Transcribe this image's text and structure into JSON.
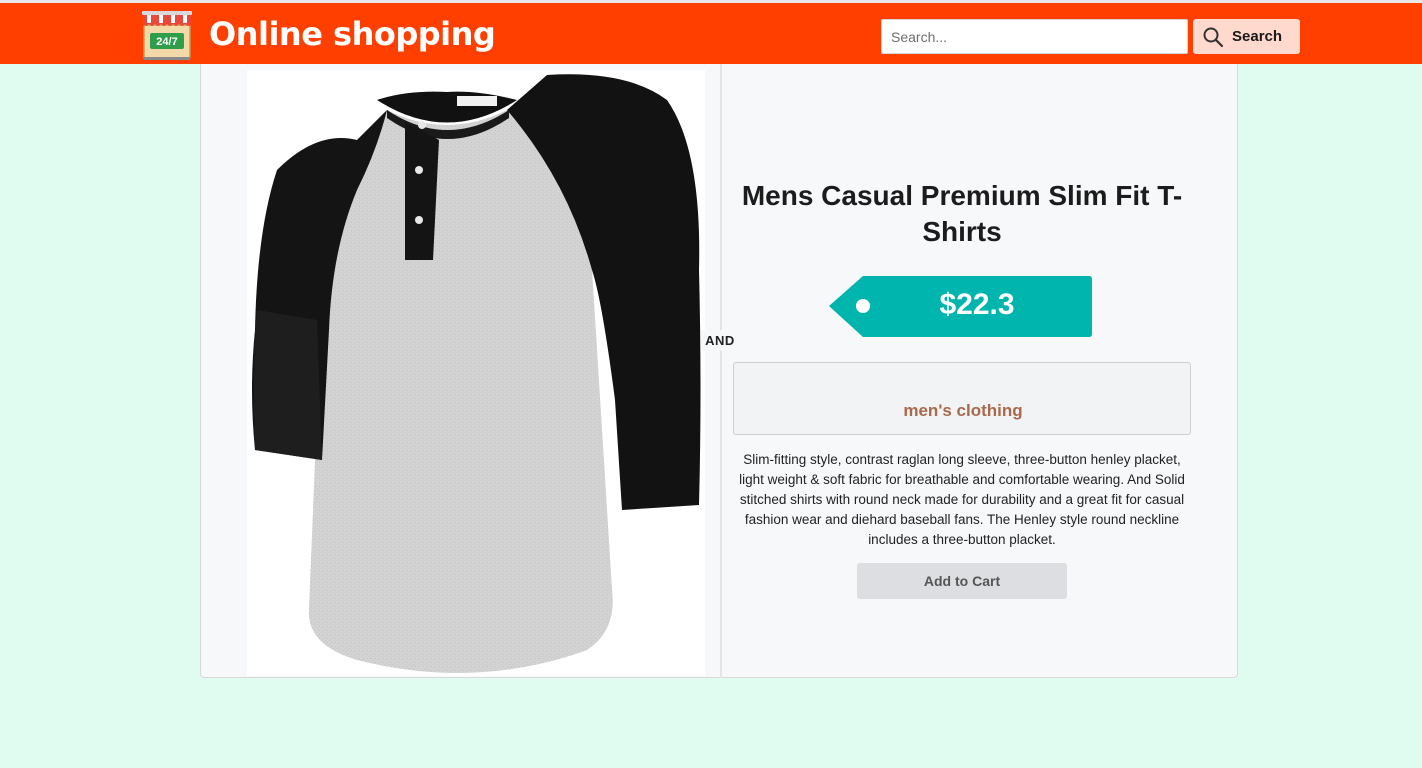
{
  "header": {
    "brand_title": "Online shopping",
    "logo_icon": "store-24-7-icon",
    "logo_text": "24/7",
    "search_placeholder": "Search...",
    "search_value": "",
    "search_button_label": "Search",
    "search_icon": "magnifier-icon",
    "bar_color": "#ff3f00"
  },
  "product": {
    "image_icon": "raglan-henley-shirt-image",
    "separator_label": "AND",
    "title": "Mens Casual Premium Slim Fit T-Shirts",
    "price": "$22.3",
    "price_tag_color": "#00b5ad",
    "category": "men's clothing",
    "description": "Slim-fitting style, contrast raglan long sleeve, three-button henley placket, light weight & soft fabric for breathable and comfortable wearing. And Solid stitched shirts with round neck made for durability and a great fit for casual fashion wear and diehard baseball fans. The Henley style round neckline includes a three-button placket.",
    "add_to_cart_label": "Add to Cart"
  }
}
